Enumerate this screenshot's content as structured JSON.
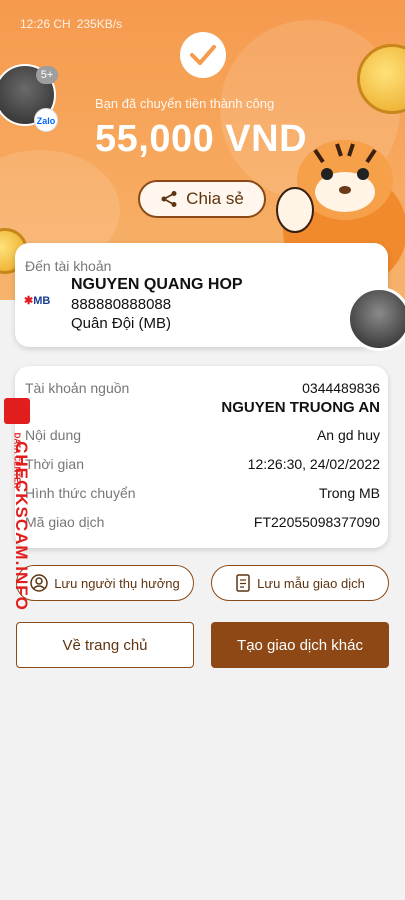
{
  "status_bar": {
    "time": "12:26 CH",
    "speed": "235KB/s"
  },
  "header": {
    "success_message": "Bạn đã chuyển tiền thành công",
    "amount": "55,000 VND",
    "share_label": "Chia sẻ"
  },
  "chat_bubble": {
    "badge_count": "5+",
    "app_badge": "Zalo"
  },
  "destination": {
    "label": "Đến tài khoản",
    "bank_logo": "MB",
    "name": "NGUYEN QUANG HOP",
    "account": "888880888088",
    "bank": "Quân Đội (MB)"
  },
  "details": {
    "source_label": "Tài khoản nguồn",
    "source_account": "0344489836",
    "source_name": "NGUYEN TRUONG AN",
    "rows": [
      {
        "label": "Nội dung",
        "value": "An gd huy"
      },
      {
        "label": "Thời gian",
        "value": "12:26:30, 24/02/2022"
      },
      {
        "label": "Hình thức chuyển",
        "value": "Trong MB"
      },
      {
        "label": "Mã giao dịch",
        "value": "FT22055098377090"
      }
    ]
  },
  "actions": {
    "save_beneficiary": "Lưu người thụ hưởng",
    "save_template": "Lưu mẫu giao dịch",
    "home": "Về trang chủ",
    "new_transaction": "Tạo giao dịch khác"
  },
  "watermark": {
    "brand": "CHECKSCAM.INFO",
    "sub": "DATA CENTER"
  },
  "colors": {
    "accent": "#8e4816",
    "header": "#f59a4e",
    "watermark": "#e11d1d"
  }
}
